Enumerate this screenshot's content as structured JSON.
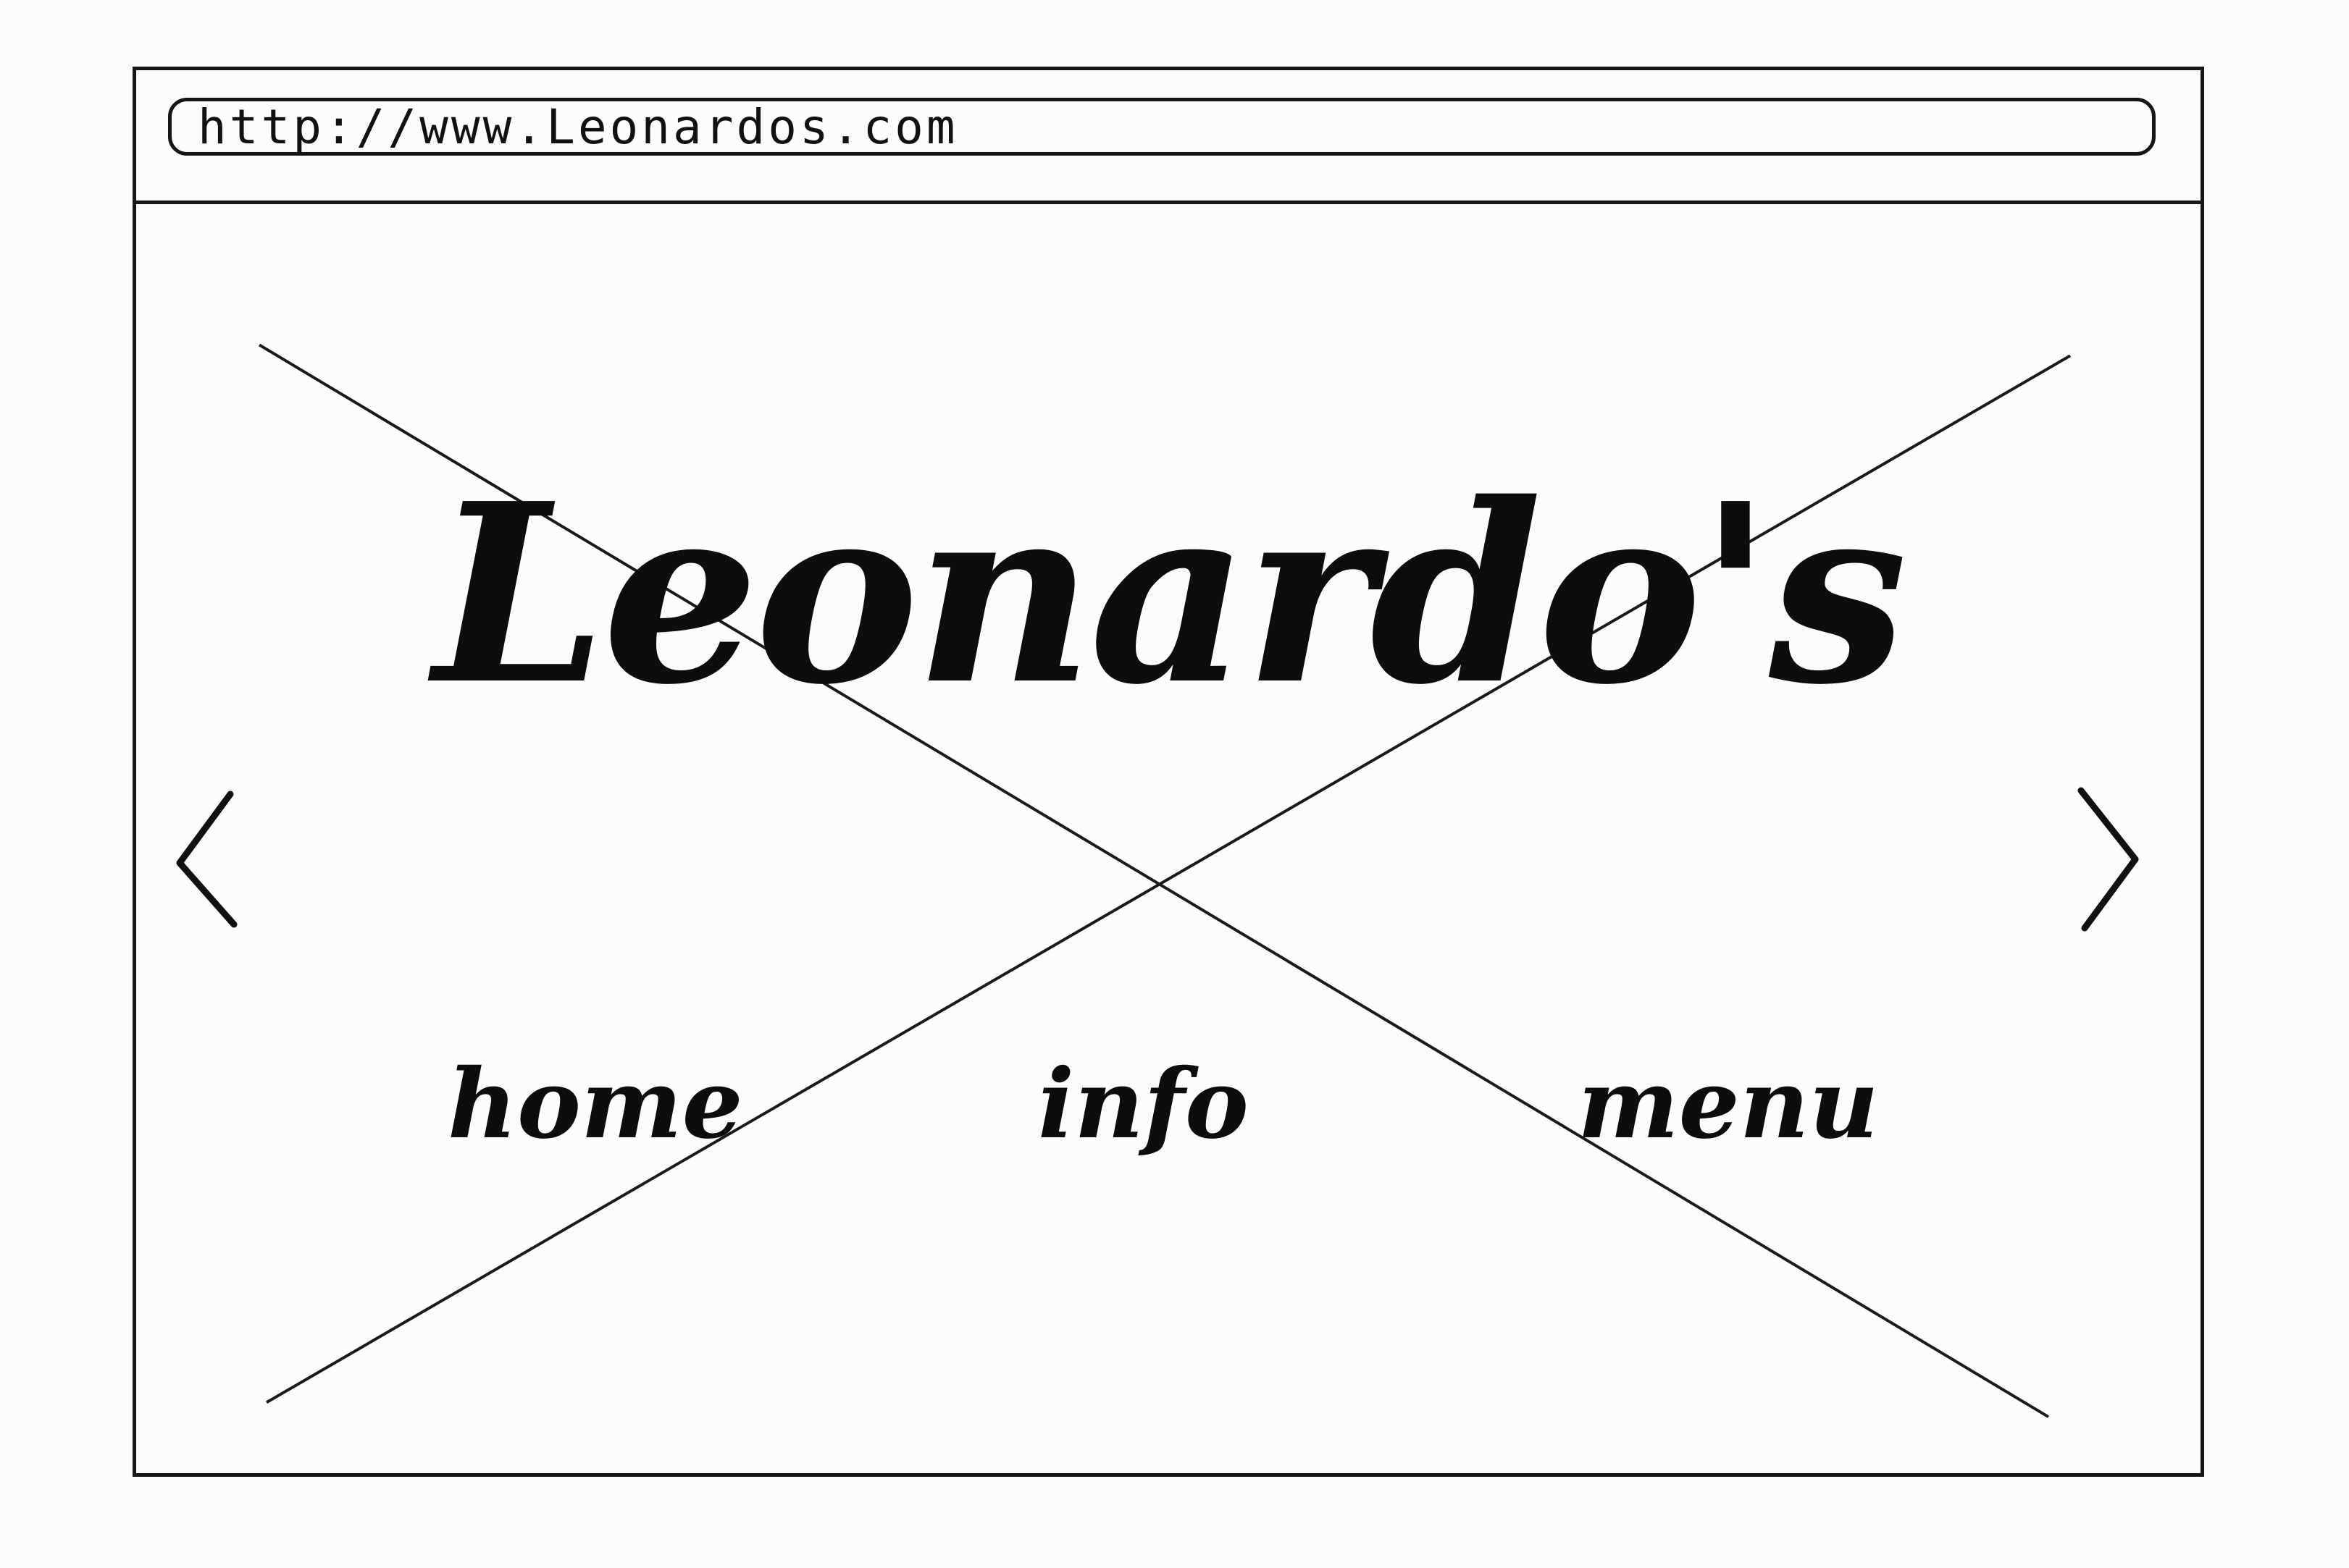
{
  "browser": {
    "url": "http://www.Leonardos.com"
  },
  "page": {
    "logo_text": "Leonardo's",
    "nav": {
      "home": "home",
      "info": "info",
      "menu": "menu"
    },
    "carousel": {
      "prev_icon": "chevron-left-icon",
      "next_icon": "chevron-right-icon"
    },
    "hero_image": "image-placeholder-x"
  },
  "colors": {
    "ink": "#111111",
    "paper": "#fcfcfa"
  }
}
